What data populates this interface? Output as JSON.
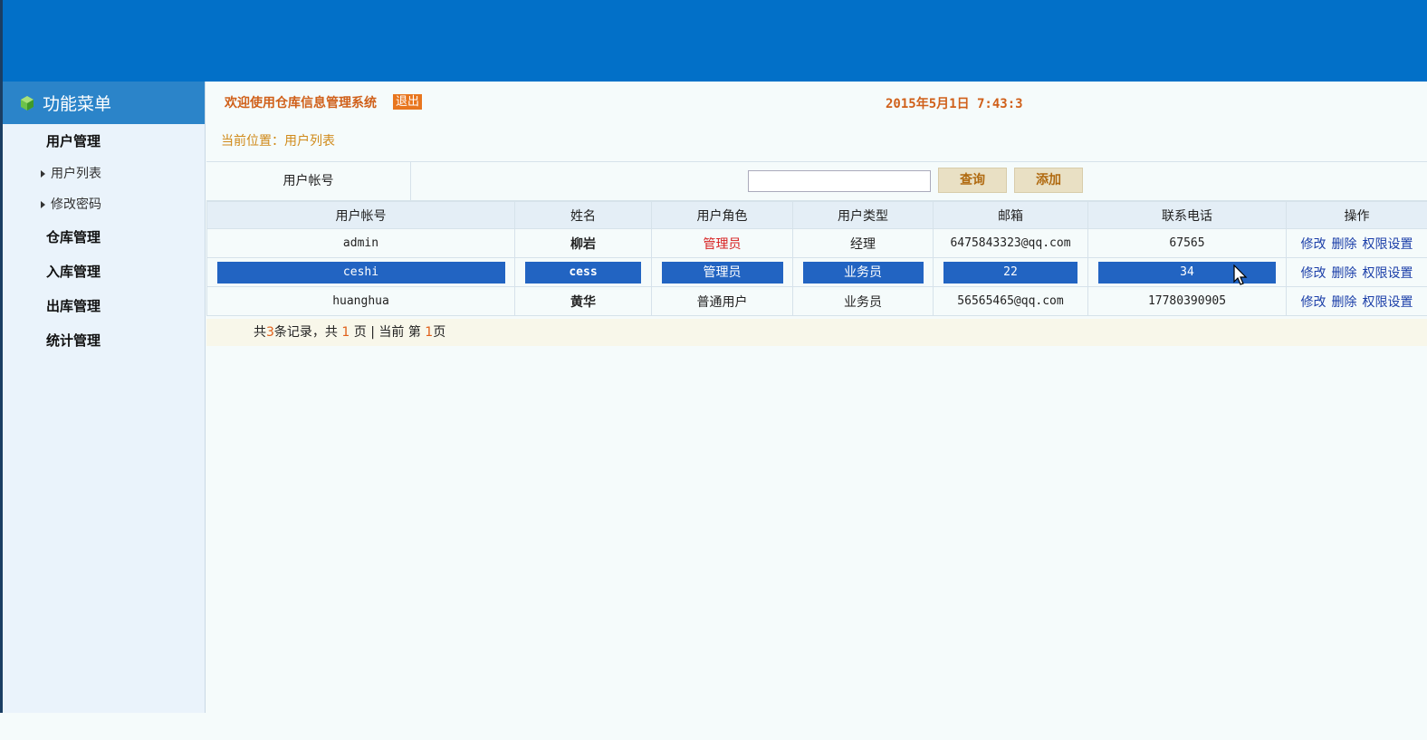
{
  "sidebar": {
    "title": "功能菜单",
    "groups": [
      {
        "label": "用户管理",
        "items": [
          "用户列表",
          "修改密码"
        ]
      },
      {
        "label": "仓库管理",
        "items": []
      },
      {
        "label": "入库管理",
        "items": []
      },
      {
        "label": "出库管理",
        "items": []
      },
      {
        "label": "统计管理",
        "items": []
      }
    ]
  },
  "header": {
    "welcome": "欢迎使用仓库信息管理系统",
    "logout": "退出",
    "datetime": "2015年5月1日 7:43:3"
  },
  "breadcrumb": "当前位置：用户列表",
  "search": {
    "label": "用户帐号",
    "value": "",
    "query_button": "查询",
    "add_button": "添加"
  },
  "table": {
    "columns": [
      "用户帐号",
      "姓名",
      "用户角色",
      "用户类型",
      "邮箱",
      "联系电话",
      "操作"
    ],
    "rows": [
      {
        "account": "admin",
        "name": "柳岩",
        "role": "管理员",
        "type": "经理",
        "email": "6475843323@qq.com",
        "phone": "67565"
      },
      {
        "account": "ceshi",
        "name": "cess",
        "role": "管理员",
        "type": "业务员",
        "email": "22",
        "phone": "34"
      },
      {
        "account": "huanghua",
        "name": "黄华",
        "role": "普通用户",
        "type": "业务员",
        "email": "56565465@qq.com",
        "phone": "17780390905"
      }
    ],
    "actions": [
      "修改",
      "删除",
      "权限设置"
    ]
  },
  "pager": {
    "p1": "共",
    "total_records": "3",
    "p2": "条记录，共",
    "total_pages": "1",
    "p3": "页 | 当前 第",
    "current_page": "1",
    "p4": "页"
  },
  "colors": {
    "topbar": "#0270c8",
    "accent": "#d0601a",
    "selection": "#2264c2"
  }
}
